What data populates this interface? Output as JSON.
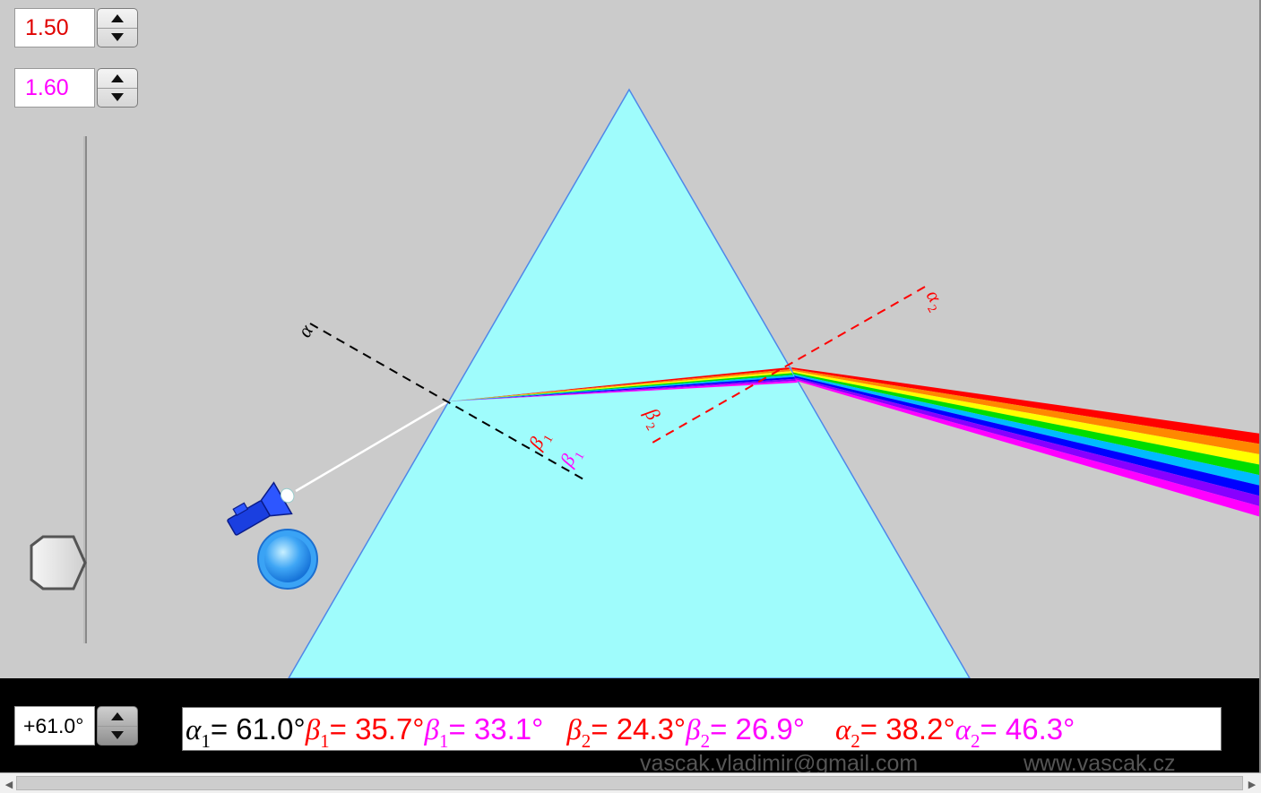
{
  "controls": {
    "index_red": {
      "value": "1.50",
      "color": "#e00000"
    },
    "index_violet": {
      "value": "1.60",
      "color": "#ff00ff"
    },
    "angle": {
      "value": "+61.0°"
    }
  },
  "diagram": {
    "labels": {
      "alpha": "α",
      "beta1": "β",
      "beta1_sub": "1",
      "beta2": "β",
      "beta2_sub": "2",
      "alpha2": "α",
      "alpha2_sub": "2"
    },
    "colors": {
      "prism": "#9ffcfc",
      "prism_edge": "#4f87e8",
      "incident_ray": "#ffffff",
      "red": "#ff0000",
      "violet": "#ff00ff",
      "normal_entry": "#000000",
      "normal_exit": "#ff0000"
    },
    "spectrum": [
      "#ff0000",
      "#ff8800",
      "#ffff00",
      "#00dd00",
      "#00bbff",
      "#0000ff",
      "#8800ff",
      "#ff00ff"
    ]
  },
  "results": {
    "alpha1": {
      "symbol": "α",
      "sub": "1",
      "value": "= 61.0°"
    },
    "beta1_red": {
      "symbol": "β",
      "sub": "1",
      "value": "= 35.7°"
    },
    "beta1_violet": {
      "symbol": "β",
      "sub": "1",
      "value": "= 33.1°"
    },
    "beta2_red": {
      "symbol": "β",
      "sub": "2",
      "value": "= 24.3°"
    },
    "beta2_violet": {
      "symbol": "β",
      "sub": "2",
      "value": "= 26.9°"
    },
    "alpha2_red": {
      "symbol": "α",
      "sub": "2",
      "value": "= 38.2°"
    },
    "alpha2_violet": {
      "symbol": "α",
      "sub": "2",
      "value": "= 46.3°"
    }
  },
  "footer": {
    "email": "vascak.vladimir@gmail.com",
    "web": "www.vascak.cz"
  }
}
